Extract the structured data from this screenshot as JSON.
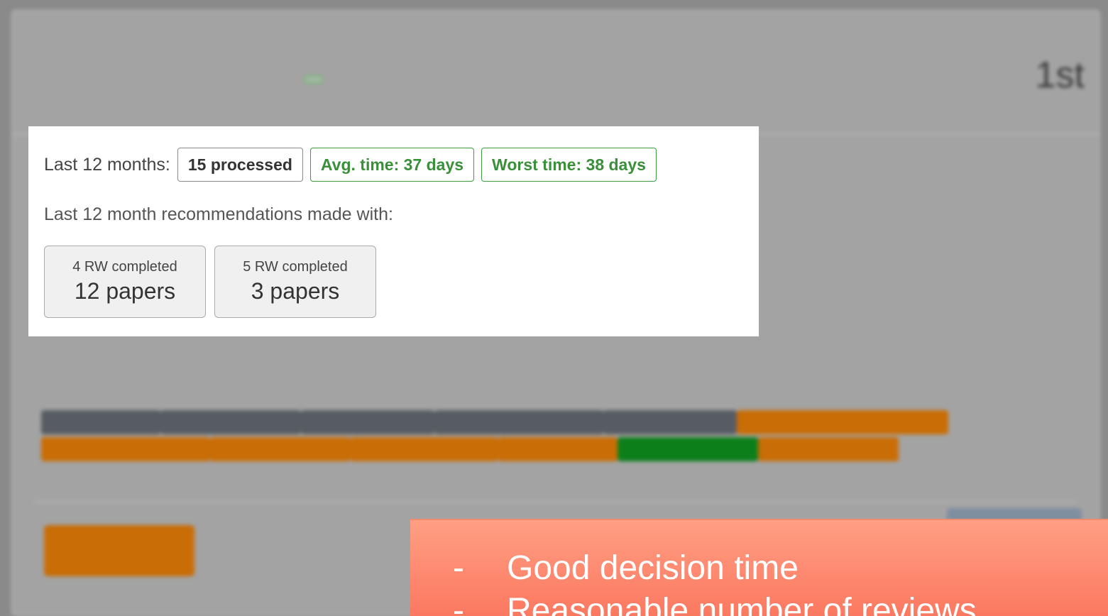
{
  "background": {
    "subtitle": "",
    "name": "",
    "badge": "",
    "rank": "1st",
    "expertise_label": "",
    "tags": [
      {
        "color": "dark"
      },
      {
        "color": "dark"
      },
      {
        "color": "dark"
      },
      {
        "color": "dark"
      },
      {
        "color": "dark"
      },
      {
        "color": "orange"
      },
      {
        "color": "orange"
      },
      {
        "color": "orange"
      },
      {
        "color": "orange"
      },
      {
        "color": "orange"
      },
      {
        "color": "green"
      },
      {
        "color": "orange"
      }
    ],
    "details_button": ""
  },
  "stats": {
    "label": "Last 12 months:",
    "processed": "15 processed",
    "avg_time": "Avg. time: 37 days",
    "worst_time": "Worst time: 38 days"
  },
  "recommendations": {
    "label": "Last 12 month recommendations made with:",
    "boxes": [
      {
        "label": "4 RW completed",
        "value": "12 papers"
      },
      {
        "label": "5 RW completed",
        "value": "3 papers"
      }
    ]
  },
  "callout": {
    "bullet": "-",
    "items": [
      "Good decision time",
      "Reasonable number of reviews"
    ]
  },
  "colors": {
    "accent_green": "#3a8f3a",
    "callout": "#fb7860",
    "tag_orange": "#c96d06",
    "tag_dark": "#575c62",
    "tag_green": "#0c7f1a"
  }
}
